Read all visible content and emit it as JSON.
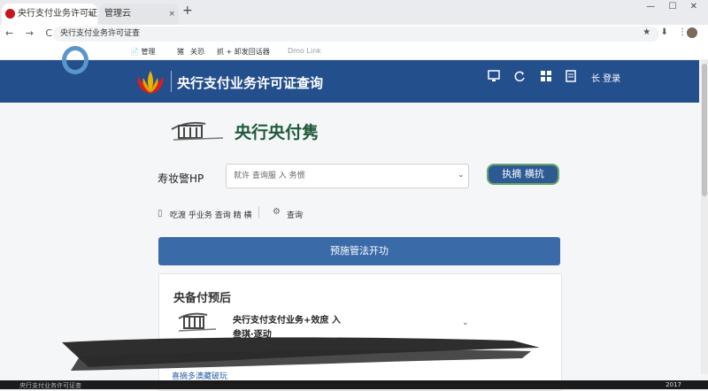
{
  "browser": {
    "tabs": [
      {
        "title": "央行支付业务许可证",
        "close": "×"
      },
      {
        "title": "管理云",
        "close": "×"
      }
    ],
    "new_tab": "+",
    "window_controls": "— ☐ ✕",
    "url": "央行支付业务许可证查",
    "nav_icons": "← → C ⌂",
    "tool_icons": "★ ⬇ ⋮",
    "bookmarks": [
      "📄 管理",
      "旺拓",
      "猪",
      "关恐",
      "抓 + 卸发回话器",
      "Dmo Link"
    ]
  },
  "header": {
    "title": "央行支付业务许可证查询",
    "icons": [
      "monitor-icon",
      "refresh-icon",
      "grid-icon",
      "doc-icon"
    ],
    "user": "长 登录"
  },
  "main": {
    "brand_title": "央行央付隽",
    "search_label": "寿妆警HP",
    "search_placeholder": "就许 查询服 入 务惯",
    "search_button": "执摘 横抗",
    "links": [
      "吃渡 乎业务 查询 精 横",
      "查询"
    ],
    "primary_button": "预施管法开功",
    "card": {
      "title": "央备付预后",
      "line1": "央行支付支付业务+效庶 入",
      "line2": "叁琪·逐动",
      "link": "喜摘多澳藏破玩"
    }
  },
  "taskbar": {
    "search": "央行支付业务许可证查",
    "time": "2017"
  },
  "colors": {
    "header_bg": "#244f8d",
    "primary": "#3a6ba8",
    "brand_green": "#1f5a3a",
    "tab_favicon": "#c8161d"
  }
}
